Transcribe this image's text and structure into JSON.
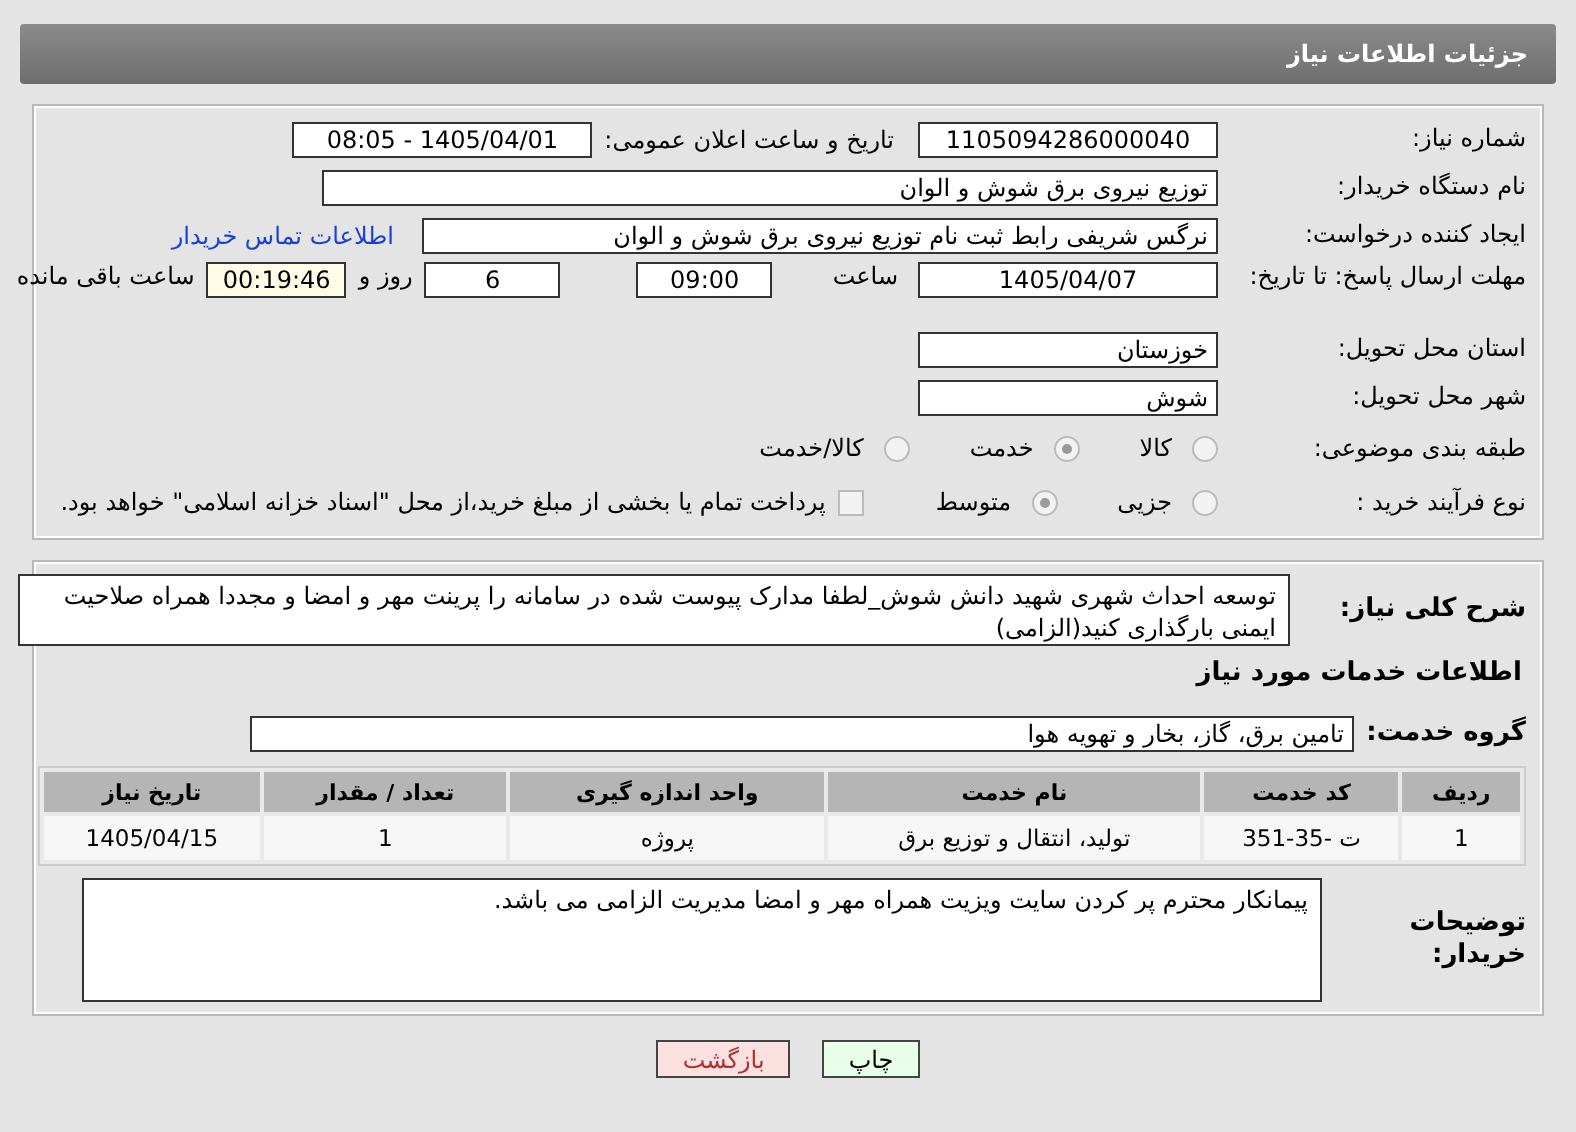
{
  "header": {
    "title": "جزئیات اطلاعات نیاز"
  },
  "need_number": {
    "label": "شماره نیاز:",
    "value": "1105094286000040"
  },
  "announce": {
    "label": "تاریخ و ساعت اعلان عمومی:",
    "value": "1405/04/01 - 08:05"
  },
  "buyer_org": {
    "label": "نام دستگاه خریدار:",
    "value": "توزیع نیروی برق شوش و الوان"
  },
  "requester": {
    "label": "ایجاد کننده درخواست:",
    "value": "نرگس شریفی رابط ثبت نام توزیع نیروی برق شوش و الوان",
    "link": "اطلاعات تماس خریدار"
  },
  "deadline": {
    "label": "مهلت ارسال پاسخ: تا تاریخ:",
    "date": "1405/04/07",
    "time_label": "ساعت",
    "time": "09:00",
    "days": "6",
    "days_label": "روز و",
    "remaining": "00:19:46",
    "remaining_label": "ساعت باقی مانده"
  },
  "province": {
    "label": "استان محل تحویل:",
    "value": "خوزستان"
  },
  "city": {
    "label": "شهر محل تحویل:",
    "value": "شوش"
  },
  "category": {
    "label": "طبقه بندی موضوعی:",
    "options": [
      {
        "label": "کالا",
        "selected": false
      },
      {
        "label": "خدمت",
        "selected": true
      },
      {
        "label": "کالا/خدمت",
        "selected": false
      }
    ]
  },
  "process": {
    "label": "نوع فرآیند خرید :",
    "options": [
      {
        "label": "جزیی",
        "selected": false
      },
      {
        "label": "متوسط",
        "selected": true
      }
    ],
    "payment": {
      "label": "پرداخت تمام یا بخشی از مبلغ خرید،از محل \"اسناد خزانه اسلامی\" خواهد بود.",
      "checked": false
    }
  },
  "description": {
    "label": "شرح کلی نیاز:",
    "value": "توسعه احداث شهری شهید دانش شوش_لطفا مدارک پیوست شده در سامانه را پرینت مهر و امضا و مجددا همراه صلاحیت ایمنی بارگذاری کنید(الزامی)"
  },
  "services_heading": "اطلاعات خدمات مورد نیاز",
  "service_group": {
    "label": "گروه خدمت:",
    "value": "تامین برق، گاز، بخار و تهویه هوا"
  },
  "table": {
    "columns": [
      "ردیف",
      "کد خدمت",
      "نام خدمت",
      "واحد اندازه گیری",
      "تعداد / مقدار",
      "تاریخ نیاز"
    ],
    "rows": [
      [
        "1",
        "ت -35-351",
        "تولید، انتقال و توزیع برق",
        "پروژه",
        "1",
        "1405/04/15"
      ]
    ]
  },
  "buyer_notes": {
    "label": "توضیحات خریدار:",
    "value": "پیمانکار محترم پر کردن سایت ویزیت همراه مهر و امضا مدیریت الزامی می باشد."
  },
  "buttons": [
    {
      "label": "چاپ",
      "kind": "print"
    },
    {
      "label": "بازگشت",
      "kind": "back"
    }
  ]
}
